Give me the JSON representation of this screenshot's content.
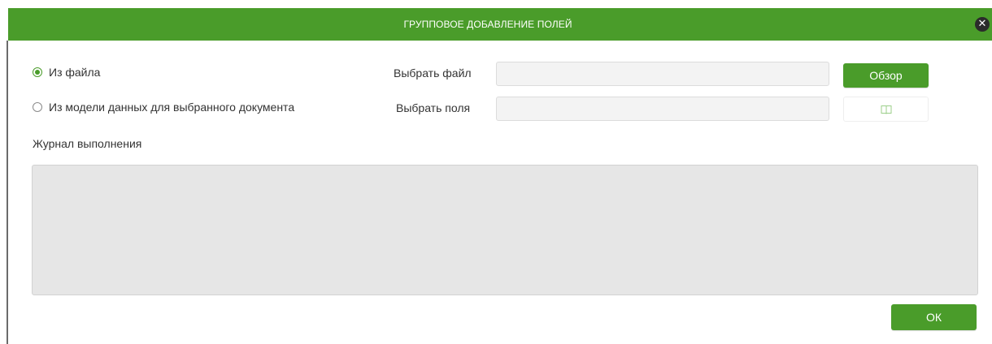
{
  "dialog": {
    "title": "ГРУППОВОЕ ДОБАВЛЕНИЕ ПОЛЕЙ",
    "close_icon": "close-icon"
  },
  "source_options": [
    {
      "label": "Из файла",
      "selected": true
    },
    {
      "label": "Из модели данных для выбранного документа",
      "selected": false
    }
  ],
  "file_row": {
    "label": "Выбрать файл",
    "value": "",
    "browse_label": "Обзор"
  },
  "fields_row": {
    "label": "Выбрать поля",
    "value": "",
    "icon": "book-icon"
  },
  "log": {
    "label": "Журнал выполнения",
    "content": ""
  },
  "footer": {
    "ok_label": "ОК"
  },
  "colors": {
    "accent": "#4a9c2a",
    "log_bg": "#e6e6e6",
    "input_bg": "#f3f3f3"
  }
}
